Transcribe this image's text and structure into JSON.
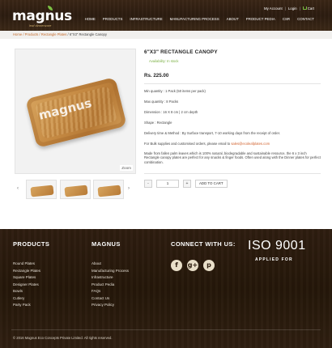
{
  "brand": {
    "name": "magnus",
    "tagline": "leaf dinnerware"
  },
  "toplinks": {
    "account": "My Account",
    "login": "Login",
    "cart": "Cart",
    "sep": "|"
  },
  "nav": [
    "HOME",
    "PRODUCTS",
    "INFRASTRUCTURE",
    "MANUFACTURING PROCESS",
    "ABOUT",
    "PRODUCT PEDIA",
    "CSR",
    "CONTACT"
  ],
  "breadcrumb": {
    "home": "Home",
    "products": "Products",
    "category": "Rectangle Plates",
    "sep": " / ",
    "current": "6\"X3\" Rectangle Canopy"
  },
  "product": {
    "title": "6\"X3\" RECTANGLE CANOPY",
    "availability": "Availability: In stock",
    "price": "Rs. 225.00",
    "image_watermark": "magnus",
    "zoom_label": "Zoom",
    "min_qty": "Min quantity : 1 Pack (50 items per pack)",
    "max_qty": "Max quantity : 8 Packs",
    "dimension": "Dimension : 16 X 8 cm | 2 cm depth",
    "shape": "Shape : Rectangle",
    "delivery": "Delivery time & Method : By Surface transport, 7-10 working days from the receipt of order.",
    "bulk_prefix": "For Bulk supplies and customised orders, please email to",
    "email": "sales@ecoleafplates.com",
    "description": "Made from fallen palm leaves which is 100% natural, biodegradable and sustainable resource, the 6 x 3 inch Rectangle canopy plates are perfect for any snacks & finger foods. Often used along with the Dinner plates for perfect combination.",
    "qty_value": "1",
    "minus": "-",
    "plus": "+",
    "add_to_cart": "ADD TO CART"
  },
  "thumbs": {
    "prev": "‹",
    "next": "›"
  },
  "footer": {
    "products_title": "PRODUCTS",
    "products": [
      "Round Plates",
      "Rectangle Plates",
      "Square Plates",
      "Designer Plates",
      "Bowls",
      "Cutlery",
      "Party Pack"
    ],
    "magnus_title": "MAGNUS",
    "magnus": [
      "About",
      "Manufacturing Process",
      "Infrastructure",
      "Product Pedia",
      "FAQs",
      "Contact Us",
      "Privacy Policy"
    ],
    "connect_title": "CONNECT WITH US:",
    "social": {
      "facebook": "f",
      "googleplus": "g+",
      "pinterest": "p"
    },
    "iso": "ISO 9001",
    "iso_sub": "APPLIED FOR",
    "copyright": "© 2016 Magnus Eco Concepts Private Limited. All rights reserved."
  }
}
